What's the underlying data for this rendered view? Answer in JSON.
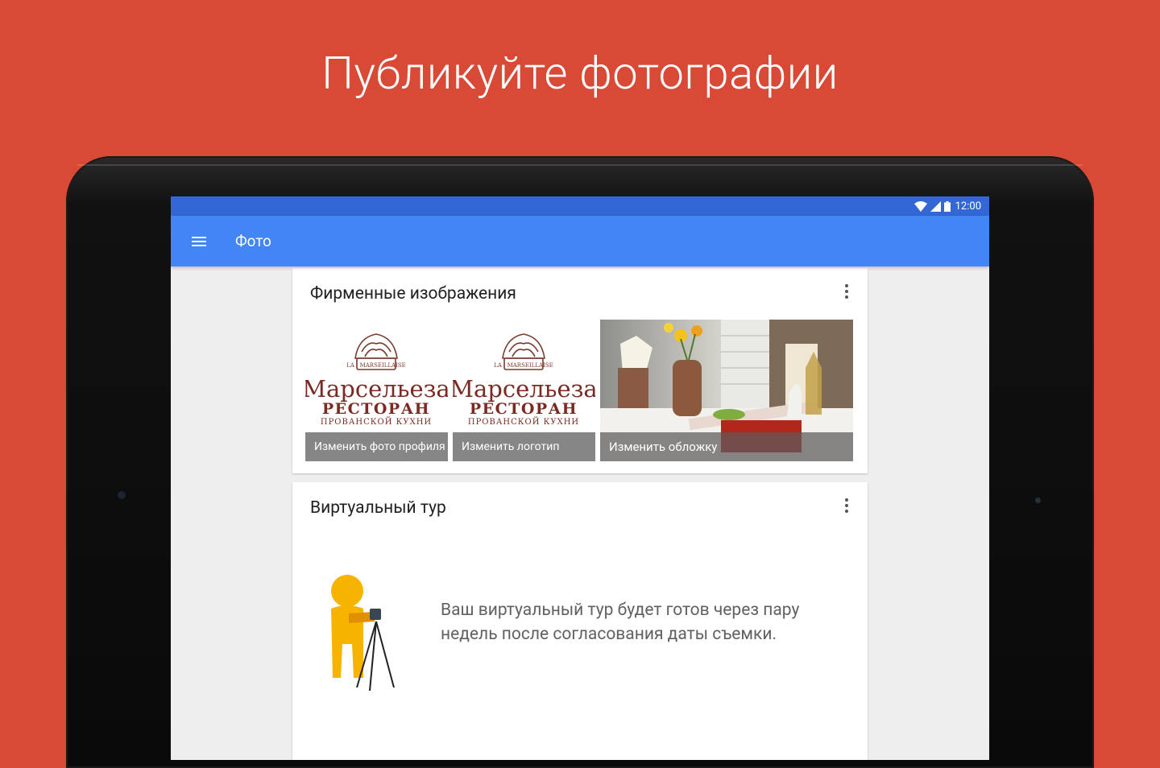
{
  "promo": {
    "title": "Публикуйте фотографии"
  },
  "statusbar": {
    "time": "12:00"
  },
  "appbar": {
    "title": "Фото"
  },
  "branding_card": {
    "title": "Фирменные изображения",
    "tiles": [
      {
        "label": "Изменить фото профиля",
        "logo_text": "Марсельеза",
        "logo_sub": "РЕСТОРАН",
        "logo_sub2": "ПРОВАНСКОЙ КУХНИ"
      },
      {
        "label": "Изменить логотип",
        "logo_text": "Марсельеза",
        "logo_sub": "РЕСТОРАН",
        "logo_sub2": "ПРОВАНСКОЙ КУХНИ"
      },
      {
        "label": "Изменить обложку"
      }
    ]
  },
  "tour_card": {
    "title": "Виртуальный тур",
    "message": "Ваш виртуальный тур будет готов через пару недель после согласования даты съемки."
  },
  "colors": {
    "background": "#D84936",
    "appbar": "#4285F4",
    "statusbar": "#3367D6"
  }
}
